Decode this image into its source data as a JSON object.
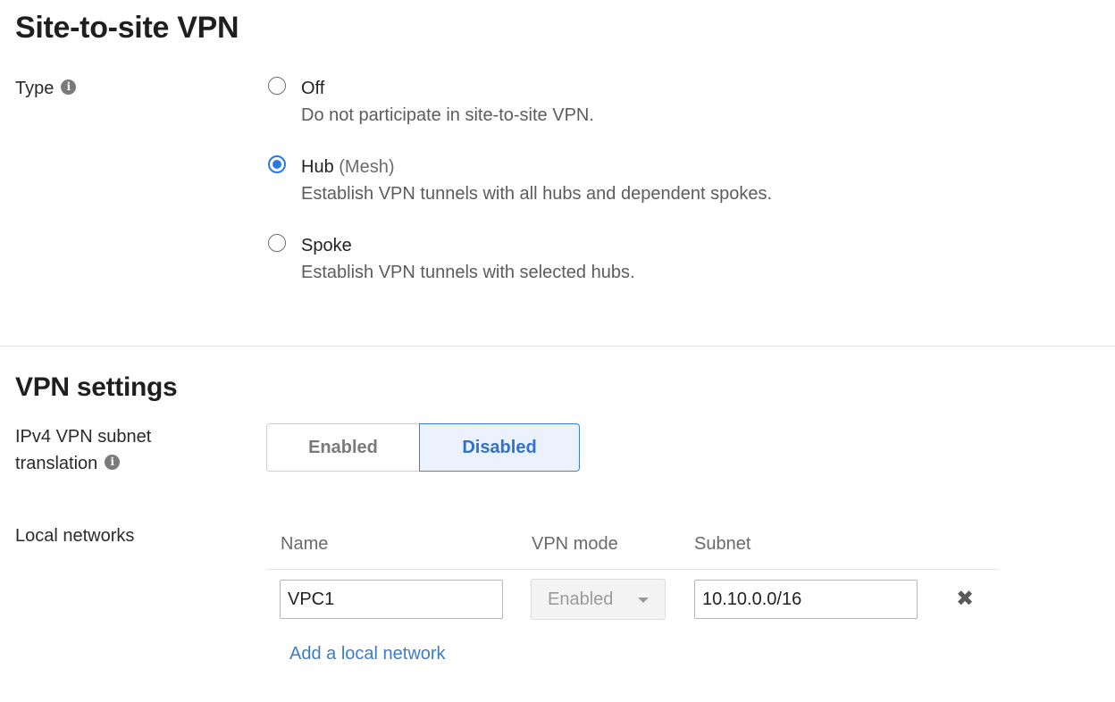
{
  "sections": {
    "site_to_site_title": "Site-to-site VPN",
    "vpn_settings_title": "VPN settings"
  },
  "type_field": {
    "label": "Type",
    "info_icon": "info-icon",
    "options": [
      {
        "label": "Off",
        "extra": "",
        "description": "Do not participate in site-to-site VPN.",
        "checked": false
      },
      {
        "label": "Hub",
        "extra": "(Mesh)",
        "description": "Establish VPN tunnels with all hubs and dependent spokes.",
        "checked": true
      },
      {
        "label": "Spoke",
        "extra": "",
        "description": "Establish VPN tunnels with selected hubs.",
        "checked": false
      }
    ]
  },
  "subnet_translation": {
    "label_line1": "IPv4 VPN subnet",
    "label_line2": "translation",
    "info_icon": "info-icon",
    "enabled_label": "Enabled",
    "disabled_label": "Disabled",
    "selected": "Disabled"
  },
  "local_networks": {
    "label": "Local networks",
    "columns": {
      "name": "Name",
      "vpn_mode": "VPN mode",
      "subnet": "Subnet"
    },
    "rows": [
      {
        "name": "VPC1",
        "vpn_mode": "Enabled",
        "subnet": "10.10.0.0/16",
        "remove_icon": "close-icon"
      }
    ],
    "add_link": "Add a local network"
  },
  "colors": {
    "accent": "#2a78e4",
    "link": "#3d7cc9",
    "selected_toggle_bg": "#ebf2fd"
  }
}
